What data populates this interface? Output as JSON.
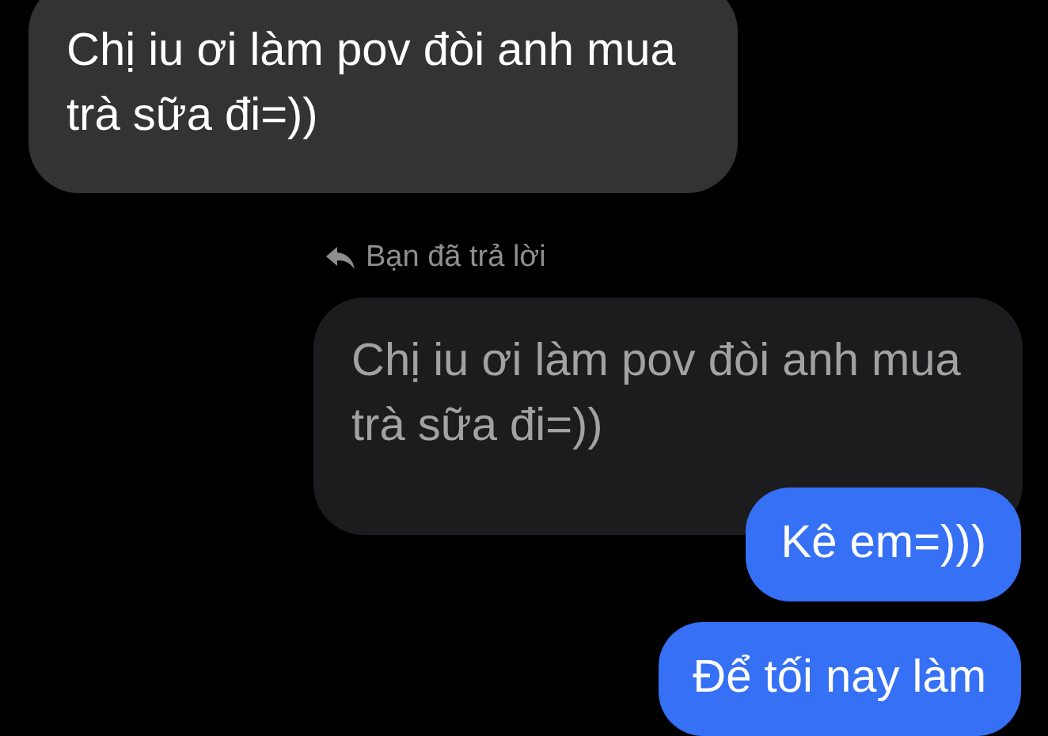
{
  "messages": [
    {
      "kind": "incoming",
      "text": "Chị iu ơi làm pov đòi anh mua trà sữa đi=))"
    },
    {
      "kind": "reply_label",
      "text": "Bạn đã trả lời"
    },
    {
      "kind": "quoted",
      "text": "Chị iu ơi làm pov đòi anh mua trà sữa đi=))"
    },
    {
      "kind": "outgoing",
      "text": "Kê em=)))"
    },
    {
      "kind": "outgoing",
      "text": "Để tối nay làm"
    }
  ]
}
